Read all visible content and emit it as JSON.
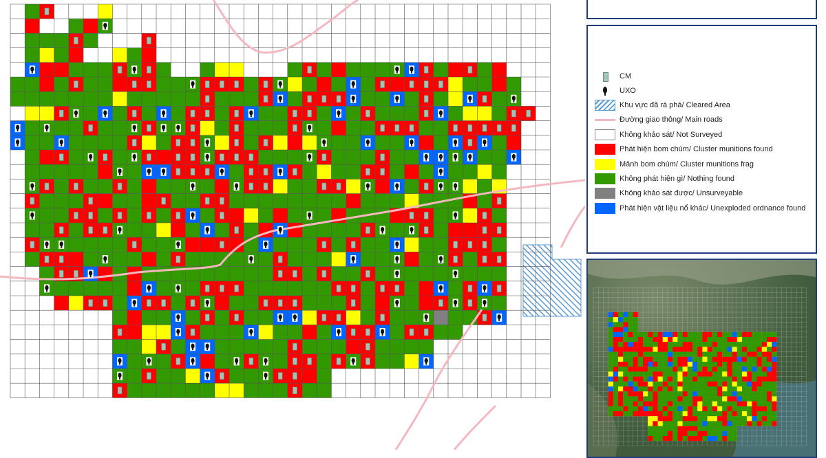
{
  "legend": {
    "items": [
      {
        "key": "cm",
        "label": "CM",
        "symbol": "cm-icon"
      },
      {
        "key": "uxo",
        "label": "UXO",
        "symbol": "uxo-icon"
      },
      {
        "key": "cleared",
        "label": "Khu vực đã rà phá/ Cleared Area",
        "color": "#5b9bd5",
        "style": "hatch"
      },
      {
        "key": "roads",
        "label": "Đường giao thông/ Main roads",
        "color": "#f4b8c0",
        "style": "line"
      },
      {
        "key": "not_surveyed",
        "label": "Không khảo sát/ Not Surveyed",
        "color": "#ffffff"
      },
      {
        "key": "cluster_found",
        "label": "Phát hiện bom chùm/ Cluster munitions found",
        "color": "#ff0000"
      },
      {
        "key": "cluster_frag",
        "label": "Mảnh bom chùm/ Cluster munitions frag",
        "color": "#ffff00"
      },
      {
        "key": "nothing",
        "label": "Không phát hiện gì/ Nothing found",
        "color": "#339900"
      },
      {
        "key": "unsurveyable",
        "label": "Không khảo sát được/ Unsurveyable",
        "color": "#808080"
      },
      {
        "key": "uxo_found",
        "label": "Phát hiện vật liệu nổ khác/ Unexploded ordnance found",
        "color": "#0066ff"
      }
    ]
  },
  "colors": {
    "grid_line": "#555555",
    "panel_border": "#1f3d7a",
    "cm_symbol": "#9fc5b6",
    "uxo_symbol": "#111111"
  }
}
